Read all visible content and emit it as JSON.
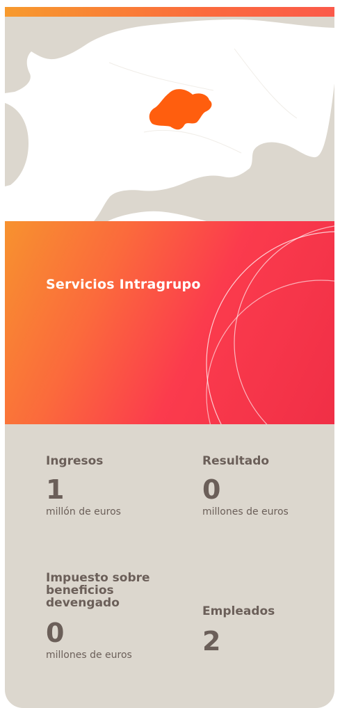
{
  "hero": {
    "title": "Servicios Intragrupo"
  },
  "stats": [
    {
      "label": "Ingresos",
      "value": "1",
      "unit": "millón de euros"
    },
    {
      "label": "Resultado",
      "value": "0",
      "unit": "millones de euros"
    },
    {
      "label": "Impuesto sobre beneficios devengado",
      "value": "0",
      "unit": "millones de euros"
    },
    {
      "label": "Empleados",
      "value": "2",
      "unit": ""
    }
  ],
  "colors": {
    "accent_orange": "#ff5e0e",
    "gradient_start": "#f7922f",
    "gradient_end": "#f02f46",
    "stats_bg": "#dcd7ce",
    "stats_text": "#6b5f59"
  }
}
